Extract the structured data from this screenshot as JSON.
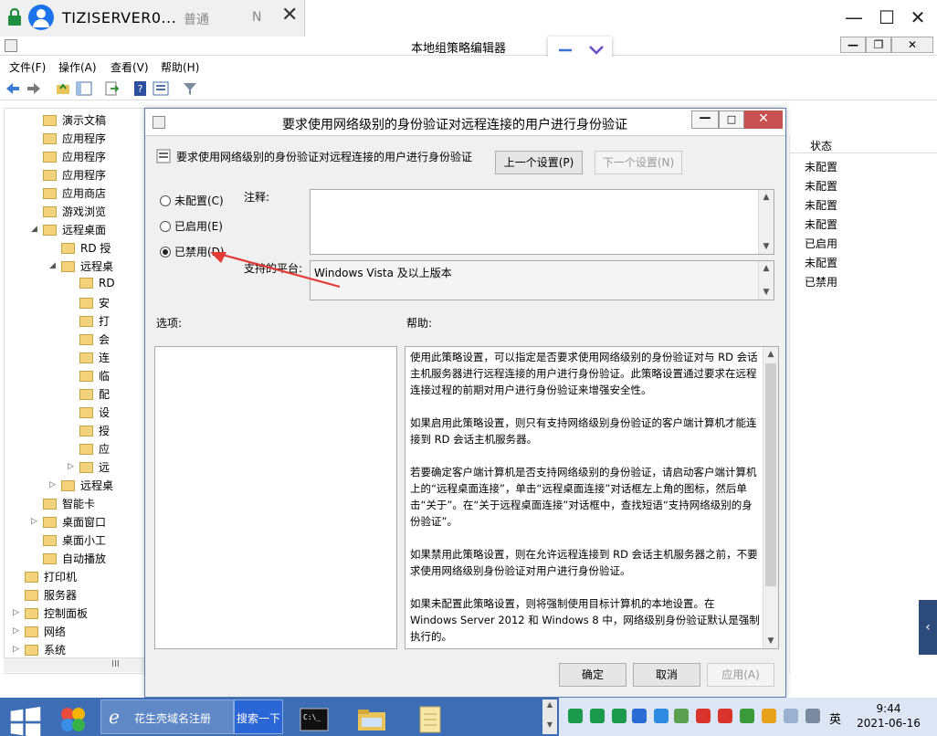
{
  "remote": {
    "title": "TIZISERVER0...",
    "mode": "普通",
    "badge": "N",
    "close": "✕",
    "minimize": "—",
    "maximize": "☐",
    "close_window": "✕"
  },
  "gpedit": {
    "title": "本地组策略编辑器",
    "menu": [
      "文件(F)",
      "操作(A)",
      "查看(V)",
      "帮助(H)"
    ],
    "window_buttons": [
      "—",
      "❐",
      "✕"
    ]
  },
  "tree": {
    "items": [
      {
        "label": "演示文稿",
        "indent": 2,
        "expander": ""
      },
      {
        "label": "应用程序",
        "indent": 2,
        "expander": ""
      },
      {
        "label": "应用程序",
        "indent": 2,
        "expander": ""
      },
      {
        "label": "应用程序",
        "indent": 2,
        "expander": ""
      },
      {
        "label": "应用商店",
        "indent": 2,
        "expander": ""
      },
      {
        "label": "游戏浏览",
        "indent": 2,
        "expander": ""
      },
      {
        "label": "远程桌面",
        "indent": 2,
        "expander": "◢"
      },
      {
        "label": "RD 授",
        "indent": 3,
        "expander": ""
      },
      {
        "label": "远程桌",
        "indent": 3,
        "expander": "◢"
      },
      {
        "label": "RD",
        "indent": 4,
        "expander": ""
      },
      {
        "label": "安",
        "indent": 4,
        "expander": ""
      },
      {
        "label": "打",
        "indent": 4,
        "expander": ""
      },
      {
        "label": "会",
        "indent": 4,
        "expander": ""
      },
      {
        "label": "连",
        "indent": 4,
        "expander": ""
      },
      {
        "label": "临",
        "indent": 4,
        "expander": ""
      },
      {
        "label": "配",
        "indent": 4,
        "expander": ""
      },
      {
        "label": "设",
        "indent": 4,
        "expander": ""
      },
      {
        "label": "授",
        "indent": 4,
        "expander": ""
      },
      {
        "label": "应",
        "indent": 4,
        "expander": ""
      },
      {
        "label": "远",
        "indent": 4,
        "expander": "▷"
      },
      {
        "label": "远程桌",
        "indent": 3,
        "expander": "▷"
      },
      {
        "label": "智能卡",
        "indent": 2,
        "expander": ""
      },
      {
        "label": "桌面窗口",
        "indent": 2,
        "expander": "▷"
      },
      {
        "label": "桌面小工",
        "indent": 2,
        "expander": ""
      },
      {
        "label": "自动播放",
        "indent": 2,
        "expander": ""
      },
      {
        "label": "打印机",
        "indent": 1,
        "expander": ""
      },
      {
        "label": "服务器",
        "indent": 1,
        "expander": ""
      },
      {
        "label": "控制面板",
        "indent": 1,
        "expander": "▷"
      },
      {
        "label": "网络",
        "indent": 1,
        "expander": "▷"
      },
      {
        "label": "系统",
        "indent": 1,
        "expander": "▷"
      }
    ],
    "scroll_marker": "III"
  },
  "list": {
    "header": "状态",
    "statuses": [
      "未配置",
      "未配置",
      "未配置",
      "未配置",
      "已启用",
      "未配置",
      "已禁用"
    ]
  },
  "dialog": {
    "title": "要求使用网络级别的身份验证对远程连接的用户进行身份验证",
    "setting_name": "要求使用网络级别的身份验证对远程连接的用户进行身份验证",
    "prev_button": "上一个设置(P)",
    "next_button": "下一个设置(N)",
    "radio_not_configured": "未配置(C)",
    "radio_enabled": "已启用(E)",
    "radio_disabled": "已禁用(D)",
    "selected": "disabled",
    "comment_label": "注释:",
    "platform_label": "支持的平台:",
    "platform_value": "Windows Vista 及以上版本",
    "options_label": "选项:",
    "help_label": "帮助:",
    "help_paragraphs": [
      "使用此策略设置，可以指定是否要求使用网络级别的身份验证对与 RD 会话主机服务器进行远程连接的用户进行身份验证。此策略设置通过要求在远程连接过程的前期对用户进行身份验证来增强安全性。",
      "如果启用此策略设置，则只有支持网络级别身份验证的客户端计算机才能连接到 RD 会话主机服务器。",
      "若要确定客户端计算机是否支持网络级别的身份验证，请启动客户端计算机上的“远程桌面连接”，单击“远程桌面连接”对话框左上角的图标，然后单击“关于”。在“关于远程桌面连接”对话框中，查找短语“支持网络级别的身份验证”。",
      "如果禁用此策略设置，则在允许远程连接到 RD 会话主机服务器之前，不要求使用网络级别身份验证对用户进行身份验证。",
      "如果未配置此策略设置，则将强制使用目标计算机的本地设置。在 Windows Server 2012 和 Windows 8 中，网络级别身份验证默认是强制执行的。"
    ],
    "ok_button": "确定",
    "cancel_button": "取消",
    "apply_button": "应用(A)",
    "min": "—",
    "max": "□",
    "close": "✕"
  },
  "taskbar": {
    "ie_label": "花生壳域名注册",
    "search_label": "搜索一下",
    "lang": "英",
    "time": "9:44",
    "date": "2021-06-16"
  },
  "colors": {
    "dialog_border": "#5a7db0",
    "close_red": "#c75050",
    "taskbar": "#3d6db5",
    "annotation_arrow": "#e53935"
  }
}
